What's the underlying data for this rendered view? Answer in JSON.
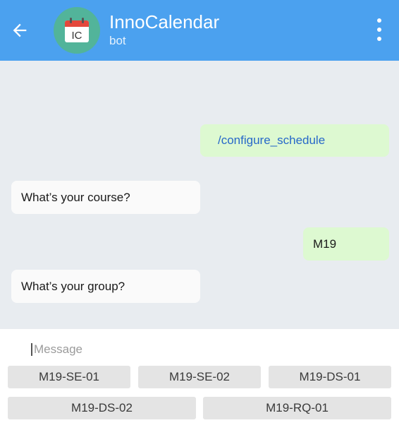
{
  "header": {
    "title": "InnoCalendar",
    "subtitle": "bot",
    "avatar_text": "IC",
    "accent": "#4ba1ef",
    "avatar_color": "#52b49a"
  },
  "messages": [
    {
      "from": "user",
      "text": "/configure_schedule"
    },
    {
      "from": "bot",
      "text": "What’s your course?"
    },
    {
      "from": "user",
      "text": "M19"
    },
    {
      "from": "bot",
      "text": "What’s your group?"
    }
  ],
  "composer": {
    "placeholder": "Message"
  },
  "keyboard": {
    "row1": [
      "M19-SE-01",
      "M19-SE-02",
      "M19-DS-01"
    ],
    "row2": [
      "M19-DS-02",
      "M19-RQ-01"
    ]
  },
  "icons": [
    "arrow-back-icon",
    "calendar-icon",
    "more-vert-icon"
  ]
}
